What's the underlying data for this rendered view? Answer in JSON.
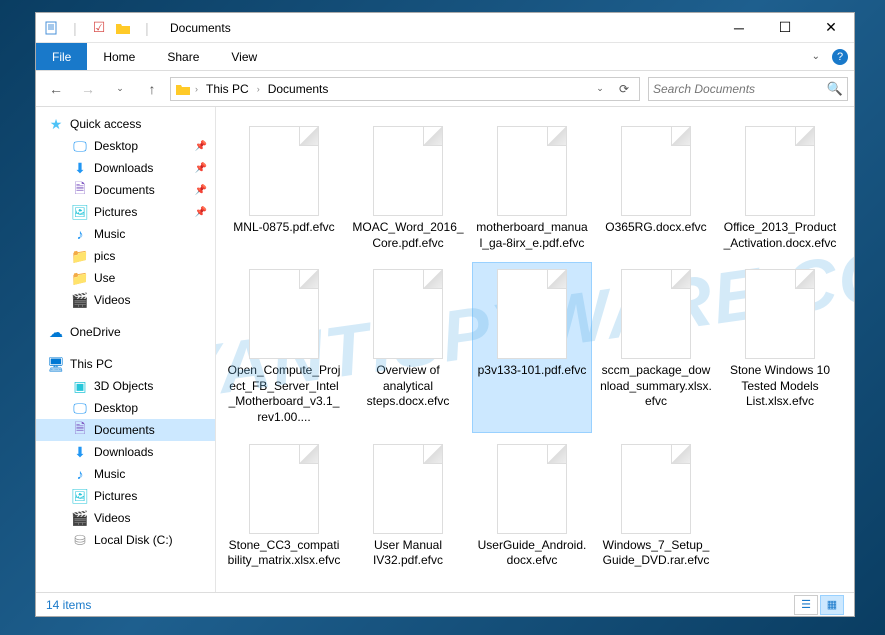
{
  "window": {
    "title": "Documents"
  },
  "ribbon": {
    "file": "File",
    "home": "Home",
    "share": "Share",
    "view": "View"
  },
  "address": {
    "seg1": "This PC",
    "seg2": "Documents"
  },
  "search": {
    "placeholder": "Search Documents"
  },
  "sidebar": {
    "quick_access": "Quick access",
    "desktop": "Desktop",
    "downloads": "Downloads",
    "documents": "Documents",
    "pictures": "Pictures",
    "music": "Music",
    "pics": "pics",
    "use": "Use",
    "videos": "Videos",
    "onedrive": "OneDrive",
    "this_pc": "This PC",
    "objects3d": "3D Objects",
    "desktop2": "Desktop",
    "documents2": "Documents",
    "downloads2": "Downloads",
    "music2": "Music",
    "pictures2": "Pictures",
    "videos2": "Videos",
    "localdisk": "Local Disk (C:)"
  },
  "files": [
    {
      "name": "MNL-0875.pdf.efvc"
    },
    {
      "name": "MOAC_Word_2016_Core.pdf.efvc"
    },
    {
      "name": "motherboard_manual_ga-8irx_e.pdf.efvc"
    },
    {
      "name": "O365RG.docx.efvc"
    },
    {
      "name": "Office_2013_Product_Activation.docx.efvc"
    },
    {
      "name": "Open_Compute_Project_FB_Server_Intel_Motherboard_v3.1_rev1.00...."
    },
    {
      "name": "Overview of analytical steps.docx.efvc"
    },
    {
      "name": "p3v133-101.pdf.efvc"
    },
    {
      "name": "sccm_package_download_summary.xlsx.efvc"
    },
    {
      "name": "Stone Windows 10 Tested Models List.xlsx.efvc"
    },
    {
      "name": "Stone_CC3_compatibility_matrix.xlsx.efvc"
    },
    {
      "name": "User Manual IV32.pdf.efvc"
    },
    {
      "name": "UserGuide_Android.docx.efvc"
    },
    {
      "name": "Windows_7_Setup_Guide_DVD.rar.efvc"
    }
  ],
  "status": {
    "count": "14 items"
  },
  "watermark": "MYANTISPYWARE.COM",
  "selected_index": 7
}
